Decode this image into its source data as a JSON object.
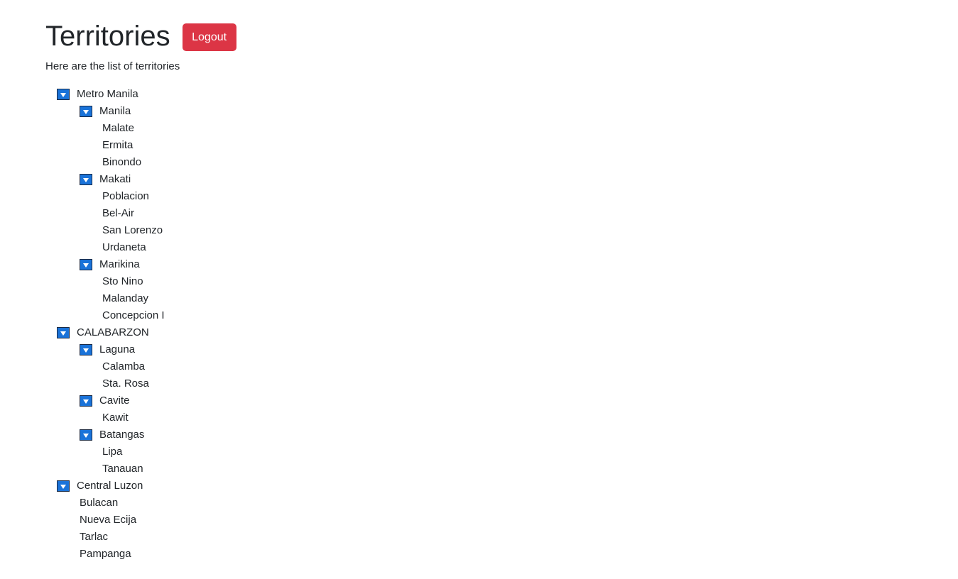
{
  "header": {
    "title": "Territories",
    "logout_label": "Logout"
  },
  "subtitle": "Here are the list of territories",
  "tree": {
    "regions": [
      {
        "label": "Metro Manila",
        "expanded": true,
        "children": [
          {
            "label": "Manila",
            "expanded": true,
            "children": [
              "Malate",
              "Ermita",
              "Binondo"
            ]
          },
          {
            "label": "Makati",
            "expanded": true,
            "children": [
              "Poblacion",
              "Bel-Air",
              "San Lorenzo",
              "Urdaneta"
            ]
          },
          {
            "label": "Marikina",
            "expanded": true,
            "children": [
              "Sto Nino",
              "Malanday",
              "Concepcion I"
            ]
          }
        ]
      },
      {
        "label": "CALABARZON",
        "expanded": true,
        "children": [
          {
            "label": "Laguna",
            "expanded": true,
            "children": [
              "Calamba",
              "Sta. Rosa"
            ]
          },
          {
            "label": "Cavite",
            "expanded": true,
            "children": [
              "Kawit"
            ]
          },
          {
            "label": "Batangas",
            "expanded": true,
            "children": [
              "Lipa",
              "Tanauan"
            ]
          }
        ]
      },
      {
        "label": "Central Luzon",
        "expanded": true,
        "children": [
          "Bulacan",
          "Nueva Ecija",
          "Tarlac",
          "Pampanga"
        ]
      }
    ]
  },
  "colors": {
    "logout_bg": "#dc3545",
    "toggle_bg": "#1a73d9"
  },
  "icons": {
    "toggle": "caret-down-icon"
  }
}
